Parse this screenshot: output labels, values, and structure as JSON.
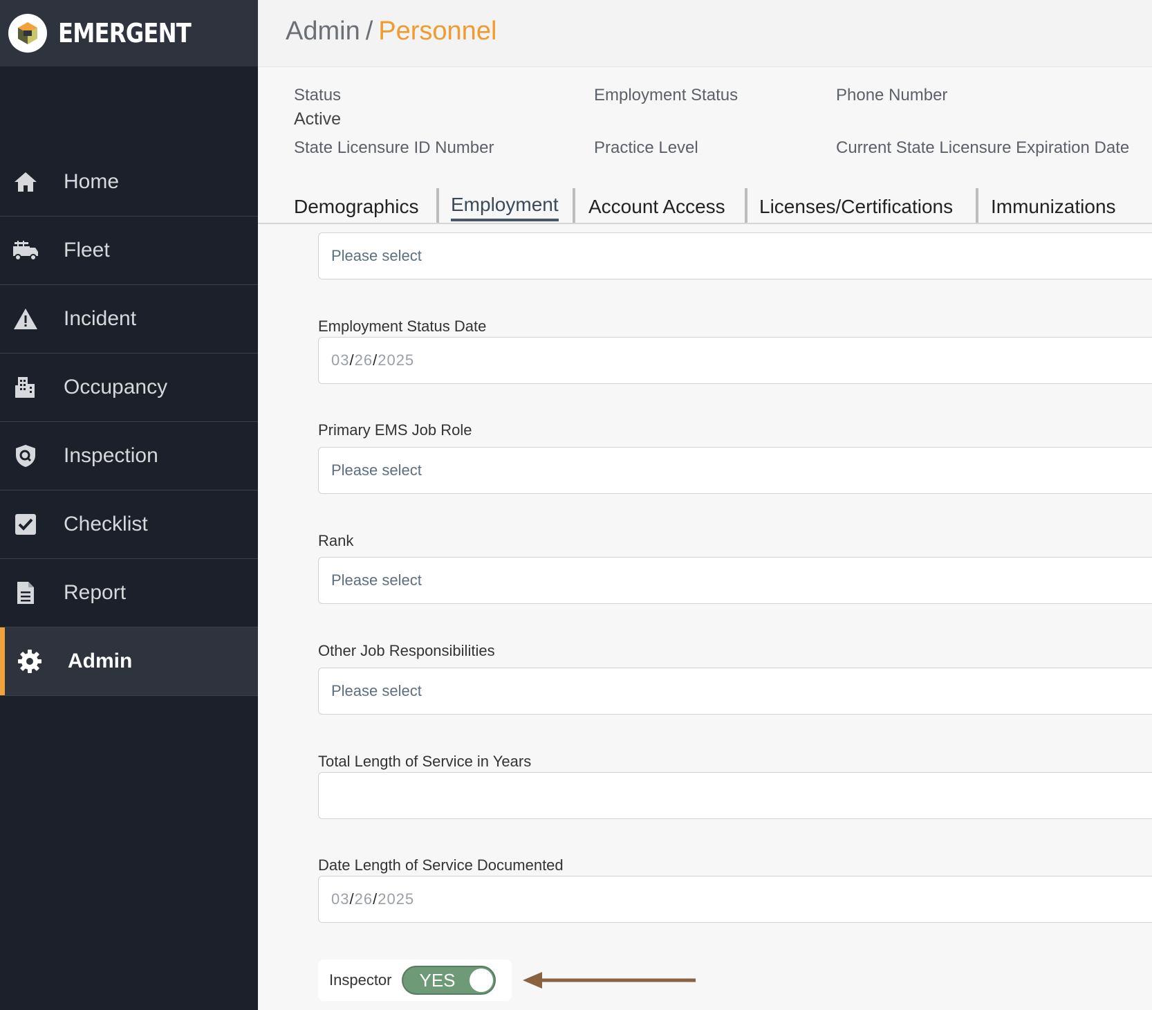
{
  "brand": {
    "name": "EMERGENT"
  },
  "sidebar": {
    "items": [
      {
        "label": "Home",
        "icon": "home-icon"
      },
      {
        "label": "Fleet",
        "icon": "fire-truck-icon"
      },
      {
        "label": "Incident",
        "icon": "warning-icon"
      },
      {
        "label": "Occupancy",
        "icon": "building-icon"
      },
      {
        "label": "Inspection",
        "icon": "shield-search-icon"
      },
      {
        "label": "Checklist",
        "icon": "checkbox-icon"
      },
      {
        "label": "Report",
        "icon": "document-icon"
      },
      {
        "label": "Admin",
        "icon": "gear-icon",
        "active": true
      }
    ]
  },
  "header": {
    "section": "Admin",
    "separator": "/",
    "page": "Personnel"
  },
  "summary": {
    "status_label": "Status",
    "status_value": "Active",
    "employment_status_label": "Employment Status",
    "phone_label": "Phone Number",
    "license_id_label": "State Licensure ID Number",
    "practice_level_label": "Practice Level",
    "license_exp_label": "Current State Licensure Expiration Date"
  },
  "tabs": [
    {
      "label": "Demographics"
    },
    {
      "label": "Employment",
      "active": true
    },
    {
      "label": "Account Access"
    },
    {
      "label": "Licenses/Certifications"
    },
    {
      "label": "Immunizations"
    }
  ],
  "form": {
    "top_select_placeholder": "Please select",
    "employment_status_date": {
      "label": "Employment Status Date",
      "month": "03",
      "day": "26",
      "year": "2025"
    },
    "primary_role": {
      "label": "Primary EMS Job Role",
      "placeholder": "Please select"
    },
    "rank": {
      "label": "Rank",
      "placeholder": "Please select"
    },
    "other_responsibilities": {
      "label": "Other Job Responsibilities",
      "placeholder": "Please select"
    },
    "total_service": {
      "label": "Total Length of Service in Years",
      "value": ""
    },
    "service_documented": {
      "label": "Date Length of Service Documented",
      "month": "03",
      "day": "26",
      "year": "2025"
    },
    "inspector": {
      "label": "Inspector",
      "toggle_text": "YES"
    },
    "date_slash": "/"
  },
  "colors": {
    "accent": "#f19a2f",
    "sidebar_bg": "#1b202a",
    "toggle_on": "#6e9a78",
    "arrow": "#8a6240"
  }
}
